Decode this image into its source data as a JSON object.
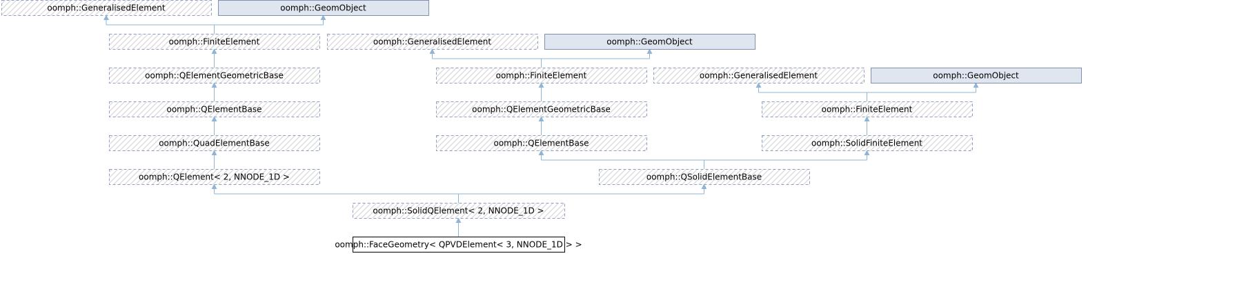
{
  "colors": {
    "edge": "#8fb4d6",
    "hatch_line": "#d8d8d8",
    "dashed_border": "#8e9fc4",
    "solid_fill": "#e0e6f0",
    "solid_border": "#7e8fb0",
    "target_border": "#000000"
  },
  "nodes": [
    {
      "id": "gen1",
      "label": "oomph::GeneralisedElement",
      "style": "dashed"
    },
    {
      "id": "geom1",
      "label": "oomph::GeomObject",
      "style": "solid"
    },
    {
      "id": "fe1",
      "label": "oomph::FiniteElement",
      "style": "dashed"
    },
    {
      "id": "gen2",
      "label": "oomph::GeneralisedElement",
      "style": "dashed"
    },
    {
      "id": "geom2",
      "label": "oomph::GeomObject",
      "style": "solid"
    },
    {
      "id": "qegb1",
      "label": "oomph::QElementGeometricBase",
      "style": "dashed"
    },
    {
      "id": "fe2",
      "label": "oomph::FiniteElement",
      "style": "dashed"
    },
    {
      "id": "gen3",
      "label": "oomph::GeneralisedElement",
      "style": "dashed"
    },
    {
      "id": "geom3",
      "label": "oomph::GeomObject",
      "style": "solid"
    },
    {
      "id": "qeb1",
      "label": "oomph::QElementBase",
      "style": "dashed"
    },
    {
      "id": "qegb2",
      "label": "oomph::QElementGeometricBase",
      "style": "dashed"
    },
    {
      "id": "fe3",
      "label": "oomph::FiniteElement",
      "style": "dashed"
    },
    {
      "id": "quad",
      "label": "oomph::QuadElementBase",
      "style": "dashed"
    },
    {
      "id": "qeb2",
      "label": "oomph::QElementBase",
      "style": "dashed"
    },
    {
      "id": "sfe",
      "label": "oomph::SolidFiniteElement",
      "style": "dashed"
    },
    {
      "id": "qe2",
      "label": "oomph::QElement< 2, NNODE_1D >",
      "style": "dashed"
    },
    {
      "id": "qseb",
      "label": "oomph::QSolidElementBase",
      "style": "dashed"
    },
    {
      "id": "sqe",
      "label": "oomph::SolidQElement< 2, NNODE_1D >",
      "style": "dashed"
    },
    {
      "id": "face",
      "label": "oomph::FaceGeometry< QPVDElement< 3, NNODE_1D > >",
      "style": "target"
    }
  ],
  "edges": [
    {
      "from": "fe1",
      "to": [
        "gen1",
        "geom1"
      ]
    },
    {
      "from": "qegb1",
      "to": [
        "fe1"
      ]
    },
    {
      "from": "qeb1",
      "to": [
        "qegb1"
      ]
    },
    {
      "from": "quad",
      "to": [
        "qeb1"
      ]
    },
    {
      "from": "qe2",
      "to": [
        "quad"
      ]
    },
    {
      "from": "fe2",
      "to": [
        "gen2",
        "geom2"
      ]
    },
    {
      "from": "qegb2",
      "to": [
        "fe2"
      ]
    },
    {
      "from": "qeb2",
      "to": [
        "qegb2"
      ]
    },
    {
      "from": "fe3",
      "to": [
        "gen3",
        "geom3"
      ]
    },
    {
      "from": "sfe",
      "to": [
        "fe3"
      ]
    },
    {
      "from": "qseb",
      "to": [
        "qeb2",
        "sfe"
      ]
    },
    {
      "from": "sqe",
      "to": [
        "qe2",
        "qseb"
      ]
    },
    {
      "from": "face",
      "to": [
        "sqe"
      ]
    }
  ]
}
